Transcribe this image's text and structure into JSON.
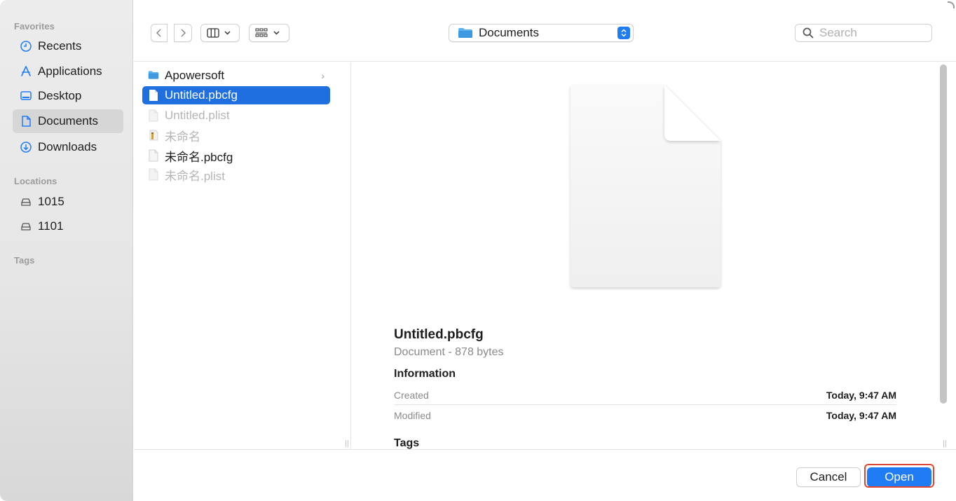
{
  "sidebar": {
    "favorites_label": "Favorites",
    "locations_label": "Locations",
    "tags_label": "Tags",
    "favorites": [
      {
        "label": "Recents",
        "icon": "clock-icon"
      },
      {
        "label": "Applications",
        "icon": "applications-icon"
      },
      {
        "label": "Desktop",
        "icon": "desktop-icon"
      },
      {
        "label": "Documents",
        "icon": "document-icon",
        "active": true
      },
      {
        "label": "Downloads",
        "icon": "download-icon"
      }
    ],
    "locations": [
      {
        "label": "1015",
        "icon": "drive-icon"
      },
      {
        "label": "1101",
        "icon": "drive-icon"
      }
    ]
  },
  "toolbar": {
    "path_folder": "Documents",
    "search_placeholder": "Search"
  },
  "files": [
    {
      "name": "Apowersoft",
      "type": "folder",
      "state": "normal"
    },
    {
      "name": "Untitled.pbcfg",
      "type": "file",
      "state": "selected"
    },
    {
      "name": "Untitled.plist",
      "type": "file",
      "state": "dim"
    },
    {
      "name": "未命名",
      "type": "archive",
      "state": "dim"
    },
    {
      "name": "未命名.pbcfg",
      "type": "file",
      "state": "normal"
    },
    {
      "name": "未命名.plist",
      "type": "file",
      "state": "dim"
    }
  ],
  "preview": {
    "title": "Untitled.pbcfg",
    "subtitle": "Document - 878 bytes",
    "info_heading": "Information",
    "created_label": "Created",
    "created_value": "Today, 9:47 AM",
    "modified_label": "Modified",
    "modified_value": "Today, 9:47 AM",
    "tags_heading": "Tags"
  },
  "buttons": {
    "cancel": "Cancel",
    "open": "Open"
  },
  "colors": {
    "accent": "#1f7cf5",
    "selection": "#1f6fe0",
    "highlight": "#e0452f"
  }
}
